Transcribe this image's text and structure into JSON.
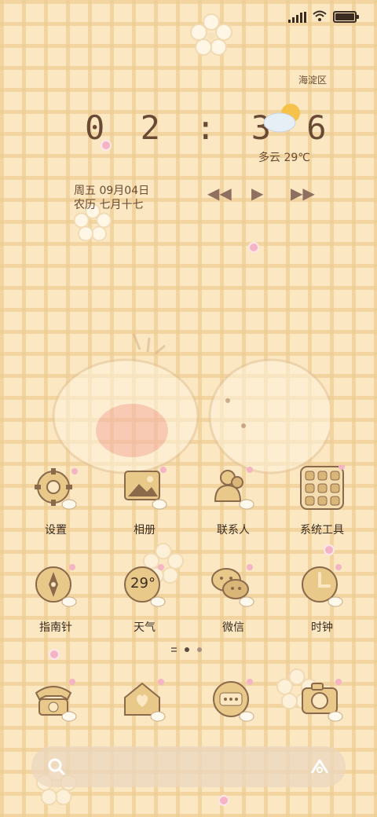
{
  "clock_widget": {
    "time": "0 2 : 3 6",
    "date": "周五 09月04日",
    "lunar": "农历 七月十七",
    "district": "海淀区",
    "weather": "多云 29℃"
  },
  "apps": [
    {
      "label": "设置",
      "icon": "gear-icon"
    },
    {
      "label": "相册",
      "icon": "gallery-icon"
    },
    {
      "label": "联系人",
      "icon": "contacts-icon"
    },
    {
      "label": "系统工具",
      "icon": "folder-grid-icon"
    },
    {
      "label": "指南针",
      "icon": "compass-icon"
    },
    {
      "label": "天气",
      "icon": "weather-icon",
      "badge": "29°"
    },
    {
      "label": "微信",
      "icon": "wechat-icon"
    },
    {
      "label": "时钟",
      "icon": "clock-icon"
    }
  ],
  "dock": [
    {
      "icon": "phone-icon"
    },
    {
      "icon": "home-heart-icon"
    },
    {
      "icon": "message-icon"
    },
    {
      "icon": "camera-icon"
    }
  ],
  "page_indicator": {
    "pages": 2,
    "current": 1
  },
  "colors": {
    "background": "#fbe7c1",
    "grid": "#eece96",
    "text": "#3b2c22",
    "accent_brown": "#8b6a4c"
  }
}
